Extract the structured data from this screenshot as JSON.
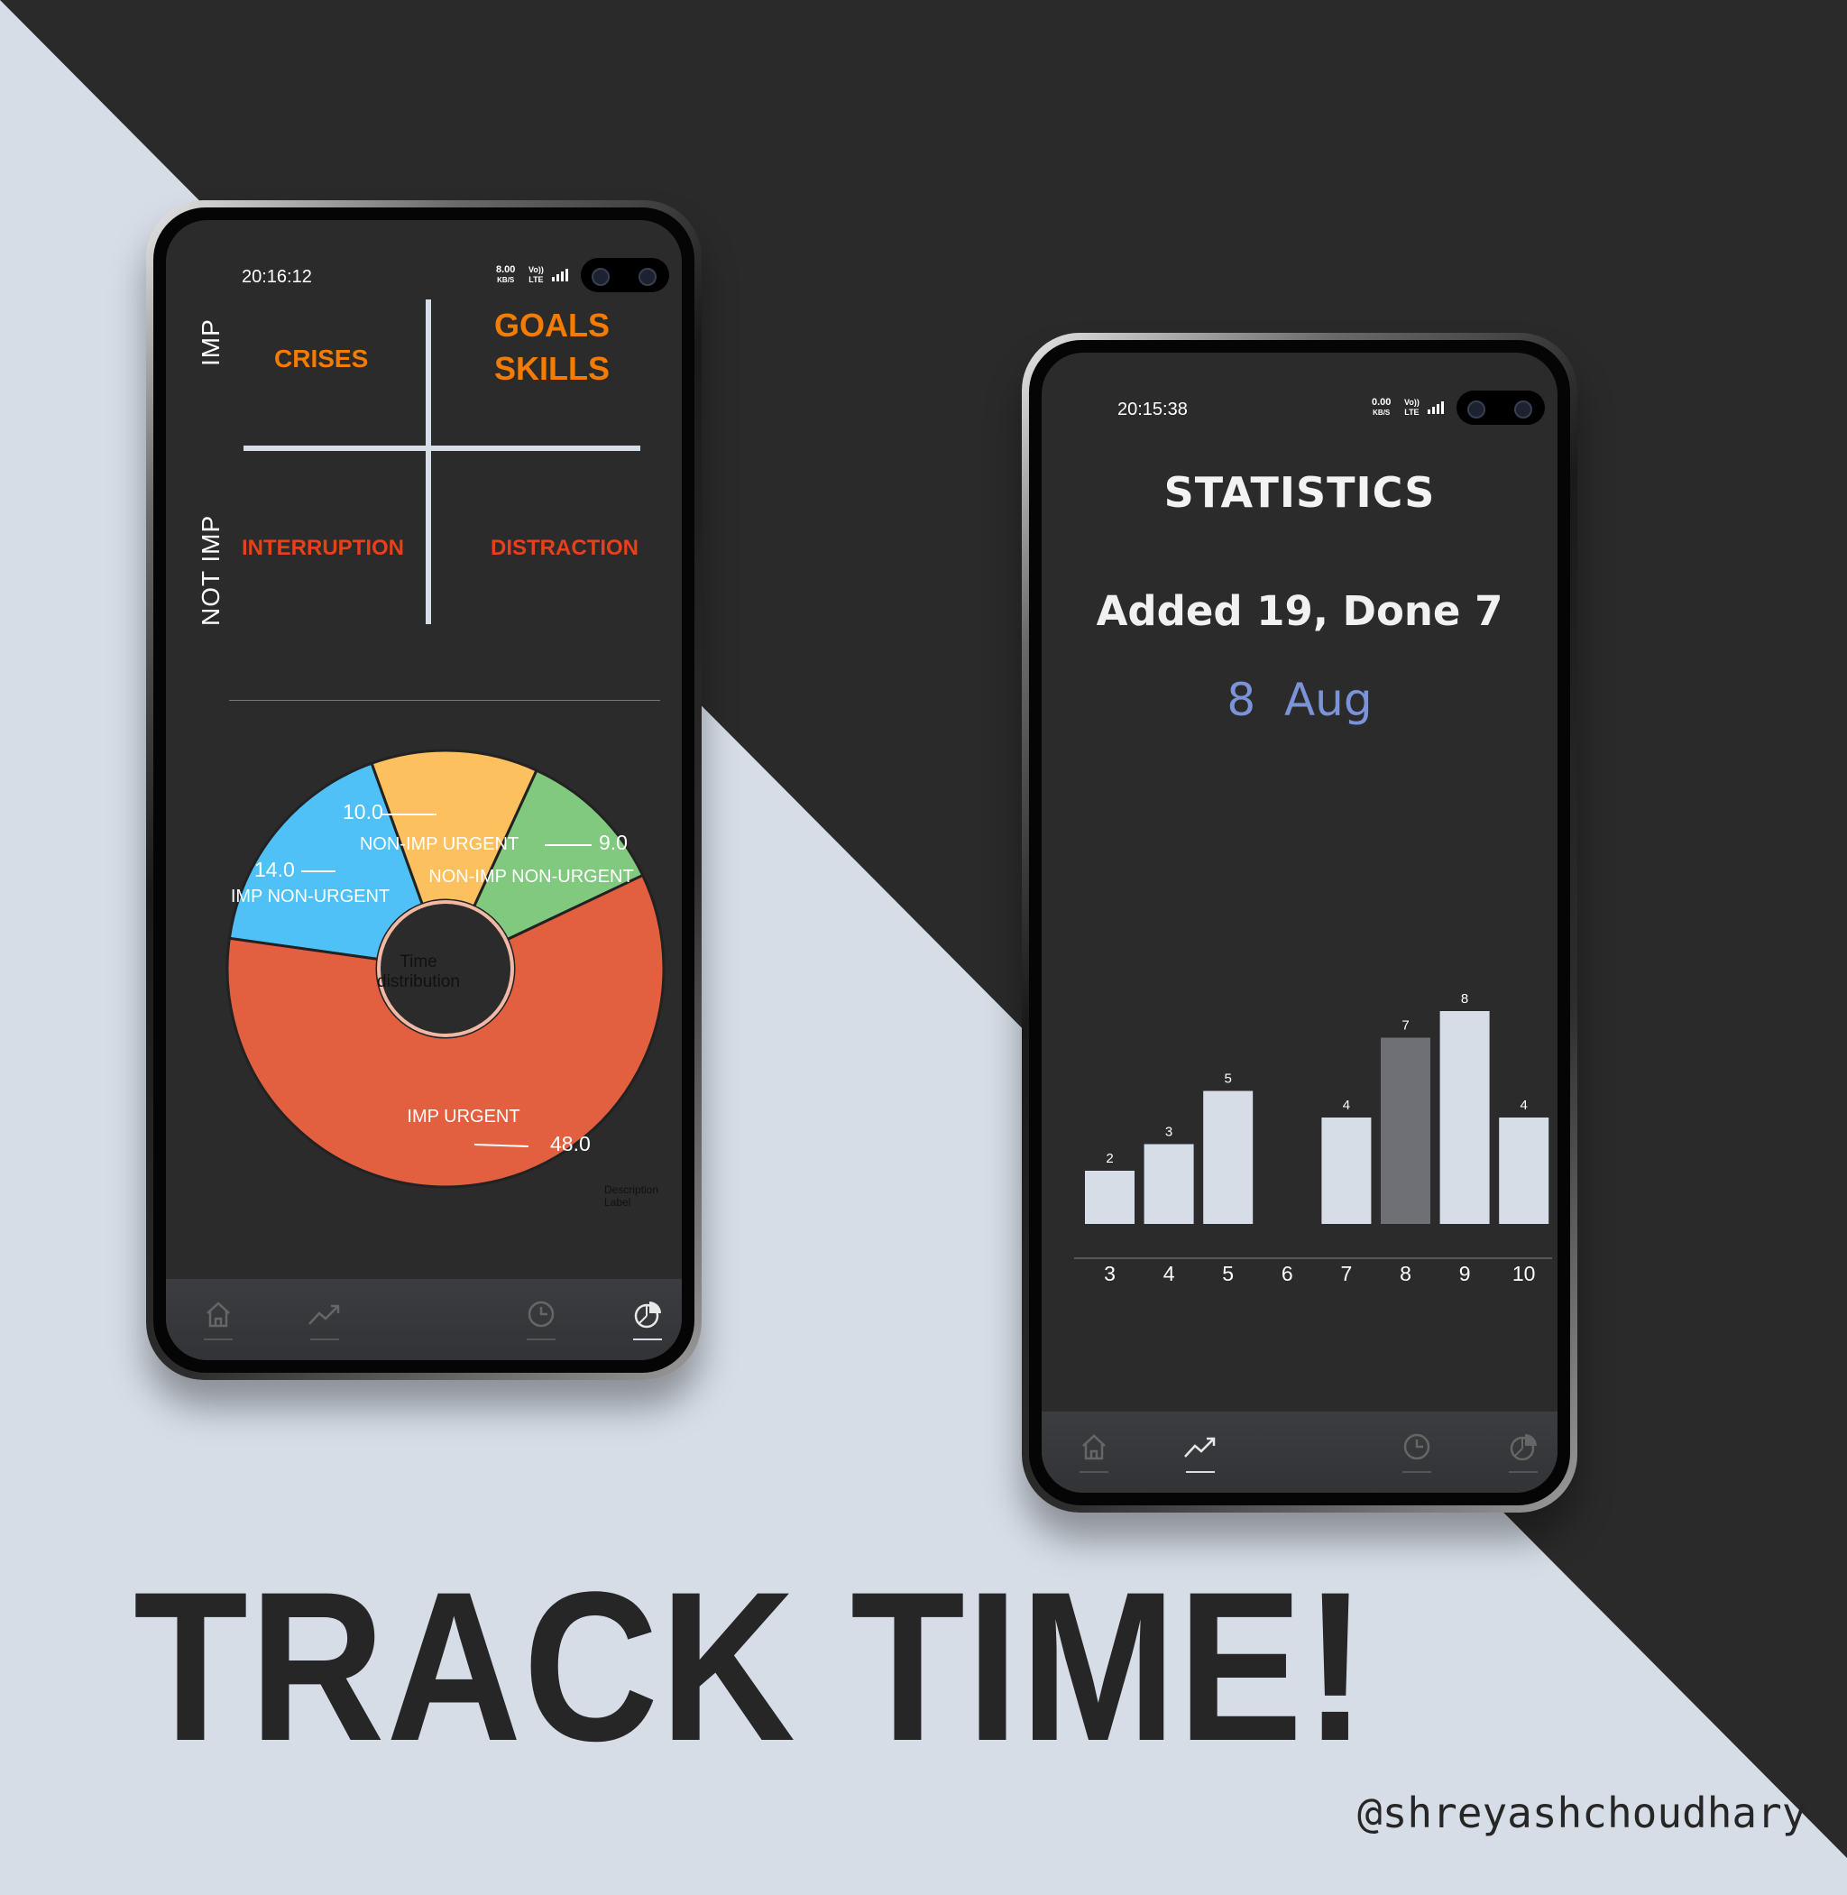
{
  "colors": {
    "background_light": "#d6dde7",
    "background_dark": "#2a2a2a",
    "screen": "#2b2b2b",
    "accent_orange": "#f57c00",
    "accent_red": "#e8401a",
    "date_blue": "#7b93d8",
    "bar_default": "#d6dde7",
    "bar_selected": "#6e7075"
  },
  "left_phone": {
    "status": {
      "time": "20:16:12",
      "net_speed": "8.00",
      "net_unit": "KB/S",
      "net_type_top": "Vo))",
      "net_type_bottom": "LTE"
    },
    "matrix": {
      "axis_important": "IMP",
      "axis_not_important": "NOT IMP",
      "q_top_left": "CRISES",
      "q_top_right_line1": "GOALS",
      "q_top_right_line2": "SKILLS",
      "q_bottom_left": "INTERRUPTION",
      "q_bottom_right": "DISTRACTION"
    },
    "pie": {
      "center_label_line1": "Time",
      "center_label_line2": "distribution",
      "description_label": "Description Label"
    },
    "nav": {
      "items": [
        {
          "icon": "home-icon",
          "active": false
        },
        {
          "icon": "trend-icon",
          "active": false
        },
        {
          "icon": "clock-icon",
          "active": false
        },
        {
          "icon": "pie-chart-icon",
          "active": true
        }
      ]
    }
  },
  "chart_data": [
    {
      "type": "pie",
      "title": "",
      "center_label": "Time distribution",
      "slices": [
        {
          "name": "IMP URGENT",
          "value": 48.0,
          "color": "#e2603f",
          "value_label": "48.0"
        },
        {
          "name": "IMP NON-URGENT",
          "value": 14.0,
          "color": "#4fc1f6",
          "value_label": "14.0"
        },
        {
          "name": "NON-IMP URGENT",
          "value": 10.0,
          "color": "#fdc05f",
          "value_label": "10.0"
        },
        {
          "name": "NON-IMP NON-URGENT",
          "value": 9.0,
          "color": "#80c97e",
          "value_label": "9.0"
        }
      ]
    },
    {
      "type": "bar",
      "title": "",
      "categories": [
        "3",
        "4",
        "5",
        "6",
        "7",
        "8",
        "9",
        "10"
      ],
      "values": [
        2,
        3,
        5,
        0,
        4,
        7,
        8,
        4
      ],
      "value_labels": [
        "2",
        "3",
        "5",
        "",
        "4",
        "7",
        "8",
        "4"
      ],
      "selected_category": "8",
      "ylim": [
        0,
        8
      ],
      "xlabel": "",
      "ylabel": ""
    }
  ],
  "right_phone": {
    "status": {
      "time": "20:15:38",
      "net_speed": "0.00",
      "net_unit": "KB/S",
      "net_type_top": "Vo))",
      "net_type_bottom": "LTE"
    },
    "title": "STATISTICS",
    "summary": "Added 19, Done 7",
    "date": "8  Aug",
    "nav": {
      "items": [
        {
          "icon": "home-icon",
          "active": false
        },
        {
          "icon": "trend-icon",
          "active": true
        },
        {
          "icon": "clock-icon",
          "active": false
        },
        {
          "icon": "pie-chart-icon",
          "active": false
        }
      ]
    }
  },
  "headline": "TRACK TIME!",
  "handle": "@shreyashchoudhary"
}
